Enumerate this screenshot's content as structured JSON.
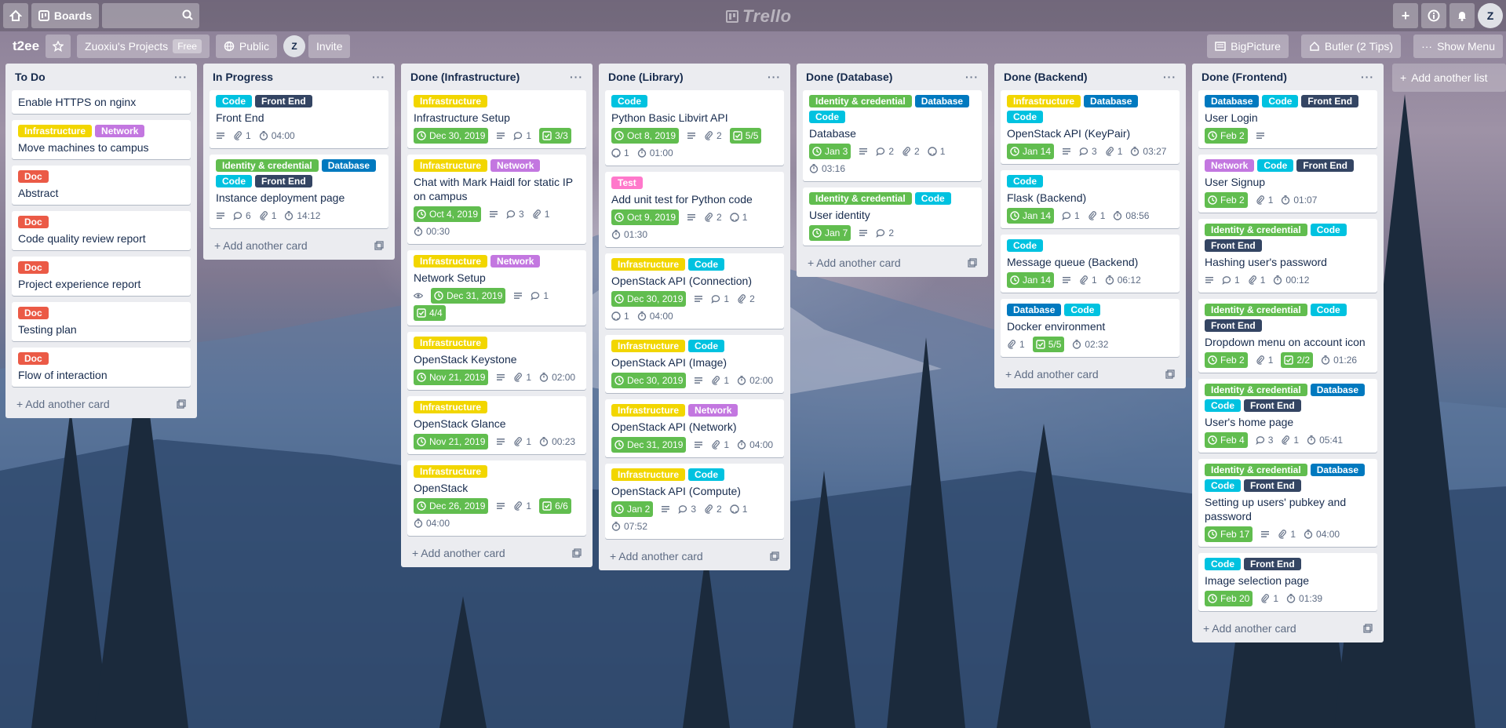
{
  "topbar": {
    "boards_label": "Boards",
    "logo_text": "Trello",
    "avatar_initial": "Z"
  },
  "board": {
    "name": "t2ee",
    "team": "Zuoxiu's Projects",
    "team_badge": "Free",
    "visibility": "Public",
    "member_initial": "Z",
    "invite": "Invite",
    "bigpicture": "BigPicture",
    "butler": "Butler (2 Tips)",
    "show_menu": "Show Menu"
  },
  "label_colors": {
    "Infrastructure": "#f2d600",
    "Network": "#c377e0",
    "Doc": "#eb5a46",
    "Code": "#00c2e0",
    "Front End": "#344563",
    "Identity & credential": "#61bd4f",
    "Database": "#0079bf",
    "Test": "#ff78cb"
  },
  "add_card": "Add another card",
  "add_list": "Add another list",
  "lists": [
    {
      "title": "To Do",
      "cards": [
        {
          "labels": [],
          "title": "Enable HTTPS on nginx",
          "badges": []
        },
        {
          "labels": [
            "Infrastructure",
            "Network"
          ],
          "title": "Move machines to campus",
          "badges": []
        },
        {
          "labels": [
            "Doc"
          ],
          "title": "Abstract",
          "badges": []
        },
        {
          "labels": [
            "Doc"
          ],
          "title": "Code quality review report",
          "badges": []
        },
        {
          "labels": [
            "Doc"
          ],
          "title": "Project experience report",
          "badges": []
        },
        {
          "labels": [
            "Doc"
          ],
          "title": "Testing plan",
          "badges": []
        },
        {
          "labels": [
            "Doc"
          ],
          "title": "Flow of interaction",
          "badges": []
        }
      ]
    },
    {
      "title": "In Progress",
      "cards": [
        {
          "labels": [
            "Code",
            "Front End"
          ],
          "title": "Front End",
          "badges": [
            {
              "t": "desc"
            },
            {
              "t": "attach",
              "v": "1"
            },
            {
              "t": "timer",
              "v": "04:00"
            }
          ]
        },
        {
          "labels": [
            "Identity & credential",
            "Database",
            "Code",
            "Front End"
          ],
          "title": "Instance deployment page",
          "badges": [
            {
              "t": "desc"
            },
            {
              "t": "comment",
              "v": "6"
            },
            {
              "t": "attach",
              "v": "1"
            },
            {
              "t": "timer",
              "v": "14:12"
            }
          ]
        }
      ]
    },
    {
      "title": "Done (Infrastructure)",
      "cards": [
        {
          "labels": [
            "Infrastructure"
          ],
          "title": "Infrastructure Setup",
          "badges": [
            {
              "t": "due",
              "v": "Dec 30, 2019"
            },
            {
              "t": "desc"
            },
            {
              "t": "comment",
              "v": "1"
            },
            {
              "t": "check",
              "v": "3/3"
            }
          ]
        },
        {
          "labels": [
            "Infrastructure",
            "Network"
          ],
          "title": "Chat with Mark Haidl for static IP on campus",
          "badges": [
            {
              "t": "due",
              "v": "Oct 4, 2019"
            },
            {
              "t": "desc"
            },
            {
              "t": "comment",
              "v": "3"
            },
            {
              "t": "attach",
              "v": "1"
            },
            {
              "t": "timer",
              "v": "00:30"
            }
          ]
        },
        {
          "labels": [
            "Infrastructure",
            "Network"
          ],
          "title": "Network Setup",
          "badges": [
            {
              "t": "watch"
            },
            {
              "t": "due",
              "v": "Dec 31, 2019"
            },
            {
              "t": "desc"
            },
            {
              "t": "comment",
              "v": "1"
            },
            {
              "t": "check",
              "v": "4/4"
            }
          ]
        },
        {
          "labels": [
            "Infrastructure"
          ],
          "title": "OpenStack Keystone",
          "badges": [
            {
              "t": "due",
              "v": "Nov 21, 2019"
            },
            {
              "t": "desc"
            },
            {
              "t": "attach",
              "v": "1"
            },
            {
              "t": "timer",
              "v": "02:00"
            }
          ]
        },
        {
          "labels": [
            "Infrastructure"
          ],
          "title": "OpenStack Glance",
          "badges": [
            {
              "t": "due",
              "v": "Nov 21, 2019"
            },
            {
              "t": "desc"
            },
            {
              "t": "attach",
              "v": "1"
            },
            {
              "t": "timer",
              "v": "00:23"
            }
          ]
        },
        {
          "labels": [
            "Infrastructure"
          ],
          "title": "OpenStack",
          "badges": [
            {
              "t": "due",
              "v": "Dec 26, 2019"
            },
            {
              "t": "desc"
            },
            {
              "t": "attach",
              "v": "1"
            },
            {
              "t": "check",
              "v": "6/6"
            },
            {
              "t": "timer",
              "v": "04:00"
            }
          ]
        }
      ]
    },
    {
      "title": "Done (Library)",
      "cards": [
        {
          "labels": [
            "Code"
          ],
          "title": "Python Basic Libvirt API",
          "badges": [
            {
              "t": "due",
              "v": "Oct 8, 2019"
            },
            {
              "t": "desc"
            },
            {
              "t": "attach",
              "v": "2"
            },
            {
              "t": "check",
              "v": "5/5"
            },
            {
              "t": "github",
              "v": "1"
            },
            {
              "t": "timer",
              "v": "01:00"
            }
          ]
        },
        {
          "labels": [
            "Test"
          ],
          "title": "Add unit test for Python code",
          "badges": [
            {
              "t": "due",
              "v": "Oct 9, 2019"
            },
            {
              "t": "desc"
            },
            {
              "t": "attach",
              "v": "2"
            },
            {
              "t": "github",
              "v": "1"
            },
            {
              "t": "timer",
              "v": "01:30"
            }
          ]
        },
        {
          "labels": [
            "Infrastructure",
            "Code"
          ],
          "title": "OpenStack API (Connection)",
          "badges": [
            {
              "t": "due",
              "v": "Dec 30, 2019"
            },
            {
              "t": "desc"
            },
            {
              "t": "comment",
              "v": "1"
            },
            {
              "t": "attach",
              "v": "2"
            },
            {
              "t": "github",
              "v": "1"
            },
            {
              "t": "timer",
              "v": "04:00"
            }
          ]
        },
        {
          "labels": [
            "Infrastructure",
            "Code"
          ],
          "title": "OpenStack API (Image)",
          "badges": [
            {
              "t": "due",
              "v": "Dec 30, 2019"
            },
            {
              "t": "desc"
            },
            {
              "t": "attach",
              "v": "1"
            },
            {
              "t": "timer",
              "v": "02:00"
            }
          ]
        },
        {
          "labels": [
            "Infrastructure",
            "Network"
          ],
          "title": "OpenStack API (Network)",
          "badges": [
            {
              "t": "due",
              "v": "Dec 31, 2019"
            },
            {
              "t": "desc"
            },
            {
              "t": "attach",
              "v": "1"
            },
            {
              "t": "timer",
              "v": "04:00"
            }
          ]
        },
        {
          "labels": [
            "Infrastructure",
            "Code"
          ],
          "title": "OpenStack API (Compute)",
          "badges": [
            {
              "t": "due",
              "v": "Jan 2"
            },
            {
              "t": "desc"
            },
            {
              "t": "comment",
              "v": "3"
            },
            {
              "t": "attach",
              "v": "2"
            },
            {
              "t": "github",
              "v": "1"
            },
            {
              "t": "timer",
              "v": "07:52"
            }
          ]
        }
      ]
    },
    {
      "title": "Done (Database)",
      "cards": [
        {
          "labels": [
            "Identity & credential",
            "Database",
            "Code"
          ],
          "title": "Database",
          "badges": [
            {
              "t": "due",
              "v": "Jan 3"
            },
            {
              "t": "desc"
            },
            {
              "t": "comment",
              "v": "2"
            },
            {
              "t": "attach",
              "v": "2"
            },
            {
              "t": "github",
              "v": "1"
            },
            {
              "t": "timer",
              "v": "03:16"
            }
          ]
        },
        {
          "labels": [
            "Identity & credential",
            "Code"
          ],
          "title": "User identity",
          "badges": [
            {
              "t": "due",
              "v": "Jan 7"
            },
            {
              "t": "desc"
            },
            {
              "t": "comment",
              "v": "2"
            }
          ]
        }
      ]
    },
    {
      "title": "Done (Backend)",
      "cards": [
        {
          "labels": [
            "Infrastructure",
            "Database",
            "Code"
          ],
          "title": "OpenStack API (KeyPair)",
          "badges": [
            {
              "t": "due",
              "v": "Jan 14"
            },
            {
              "t": "desc"
            },
            {
              "t": "comment",
              "v": "3"
            },
            {
              "t": "attach",
              "v": "1"
            },
            {
              "t": "timer",
              "v": "03:27"
            }
          ]
        },
        {
          "labels": [
            "Code"
          ],
          "title": "Flask (Backend)",
          "badges": [
            {
              "t": "due",
              "v": "Jan 14"
            },
            {
              "t": "comment",
              "v": "1"
            },
            {
              "t": "attach",
              "v": "1"
            },
            {
              "t": "timer",
              "v": "08:56"
            }
          ]
        },
        {
          "labels": [
            "Code"
          ],
          "title": "Message queue (Backend)",
          "badges": [
            {
              "t": "due",
              "v": "Jan 14"
            },
            {
              "t": "desc"
            },
            {
              "t": "attach",
              "v": "1"
            },
            {
              "t": "timer",
              "v": "06:12"
            }
          ]
        },
        {
          "labels": [
            "Database",
            "Code"
          ],
          "title": "Docker environment",
          "badges": [
            {
              "t": "attach",
              "v": "1"
            },
            {
              "t": "check",
              "v": "5/5"
            },
            {
              "t": "timer",
              "v": "02:32"
            }
          ]
        }
      ]
    },
    {
      "title": "Done (Frontend)",
      "cards": [
        {
          "labels": [
            "Database",
            "Code",
            "Front End"
          ],
          "title": "User Login",
          "badges": [
            {
              "t": "due",
              "v": "Feb 2"
            },
            {
              "t": "desc"
            }
          ]
        },
        {
          "labels": [
            "Network",
            "Code",
            "Front End"
          ],
          "title": "User Signup",
          "badges": [
            {
              "t": "due",
              "v": "Feb 2"
            },
            {
              "t": "attach",
              "v": "1"
            },
            {
              "t": "timer",
              "v": "01:07"
            }
          ]
        },
        {
          "labels": [
            "Identity & credential",
            "Code",
            "Front End"
          ],
          "title": "Hashing user's password",
          "badges": [
            {
              "t": "desc"
            },
            {
              "t": "comment",
              "v": "1"
            },
            {
              "t": "attach",
              "v": "1"
            },
            {
              "t": "timer",
              "v": "00:12"
            }
          ]
        },
        {
          "labels": [
            "Identity & credential",
            "Code",
            "Front End"
          ],
          "title": "Dropdown menu on account icon",
          "badges": [
            {
              "t": "due",
              "v": "Feb 2"
            },
            {
              "t": "attach",
              "v": "1"
            },
            {
              "t": "check",
              "v": "2/2"
            },
            {
              "t": "timer",
              "v": "01:26"
            }
          ]
        },
        {
          "labels": [
            "Identity & credential",
            "Database",
            "Code",
            "Front End"
          ],
          "title": "User's home page",
          "badges": [
            {
              "t": "due",
              "v": "Feb 4"
            },
            {
              "t": "comment",
              "v": "3"
            },
            {
              "t": "attach",
              "v": "1"
            },
            {
              "t": "timer",
              "v": "05:41"
            }
          ]
        },
        {
          "labels": [
            "Identity & credential",
            "Database",
            "Code",
            "Front End"
          ],
          "title": "Setting up users' pubkey and password",
          "badges": [
            {
              "t": "due",
              "v": "Feb 17"
            },
            {
              "t": "desc"
            },
            {
              "t": "attach",
              "v": "1"
            },
            {
              "t": "timer",
              "v": "04:00"
            }
          ]
        },
        {
          "labels": [
            "Code",
            "Front End"
          ],
          "title": "Image selection page",
          "badges": [
            {
              "t": "due",
              "v": "Feb 20"
            },
            {
              "t": "attach",
              "v": "1"
            },
            {
              "t": "timer",
              "v": "01:39"
            }
          ]
        }
      ]
    }
  ]
}
